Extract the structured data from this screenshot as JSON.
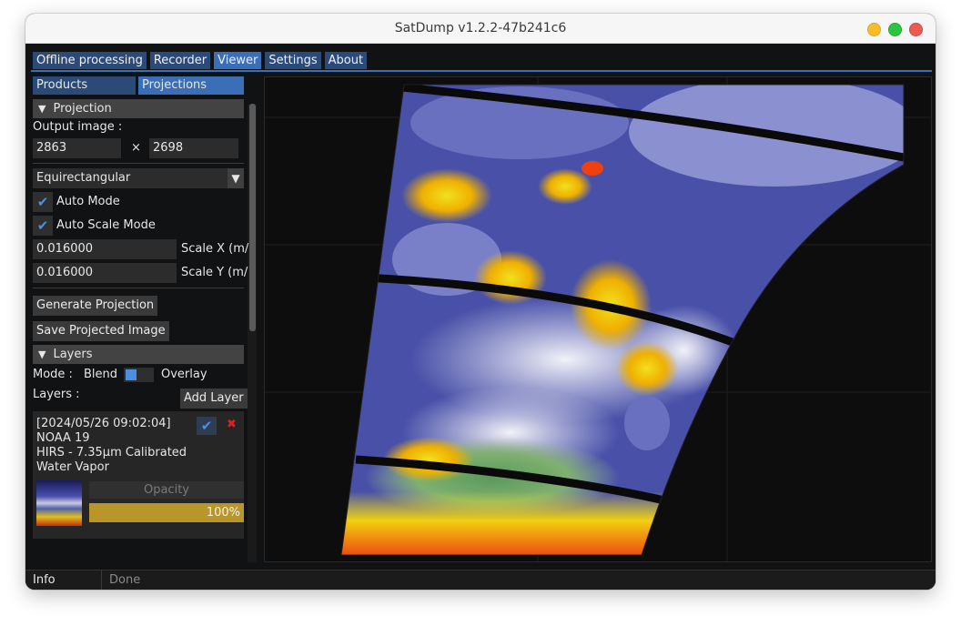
{
  "window": {
    "title": "SatDump v1.2.2-47b241c6"
  },
  "tabs": [
    {
      "label": "Offline processing"
    },
    {
      "label": "Recorder"
    },
    {
      "label": "Viewer"
    },
    {
      "label": "Settings"
    },
    {
      "label": "About"
    }
  ],
  "subtabs": [
    {
      "label": "Products"
    },
    {
      "label": "Projections"
    }
  ],
  "projection": {
    "header": "Projection",
    "output_label": "Output image :",
    "width": "2863",
    "height": "2698",
    "times": "×",
    "type": "Equirectangular",
    "auto_mode": "Auto Mode",
    "auto_scale": "Auto Scale Mode",
    "scale_x_value": "0.016000",
    "scale_x_label": "Scale X (m/",
    "scale_y_value": "0.016000",
    "scale_y_label": "Scale Y (m/",
    "generate": "Generate Projection",
    "save": "Save Projected Image"
  },
  "layers": {
    "header": "Layers",
    "mode_label": "Mode :",
    "blend": "Blend",
    "overlay": "Overlay",
    "layers_label": "Layers :",
    "add_layer": "Add Layer",
    "items": [
      {
        "timestamp": "[2024/05/26 09:02:04]",
        "satellite": "NOAA 19",
        "product": "HIRS - 7.35µm Calibrated",
        "product2": "Water Vapor",
        "opacity_label": "Opacity",
        "opacity": "100%",
        "opacity_fraction": 1.0
      }
    ]
  },
  "status": {
    "label": "Info",
    "message": "Done"
  },
  "colors": {
    "accent": "#3a6fb8",
    "tab": "#2b4a78",
    "opacity_fill": "#b8962a"
  }
}
